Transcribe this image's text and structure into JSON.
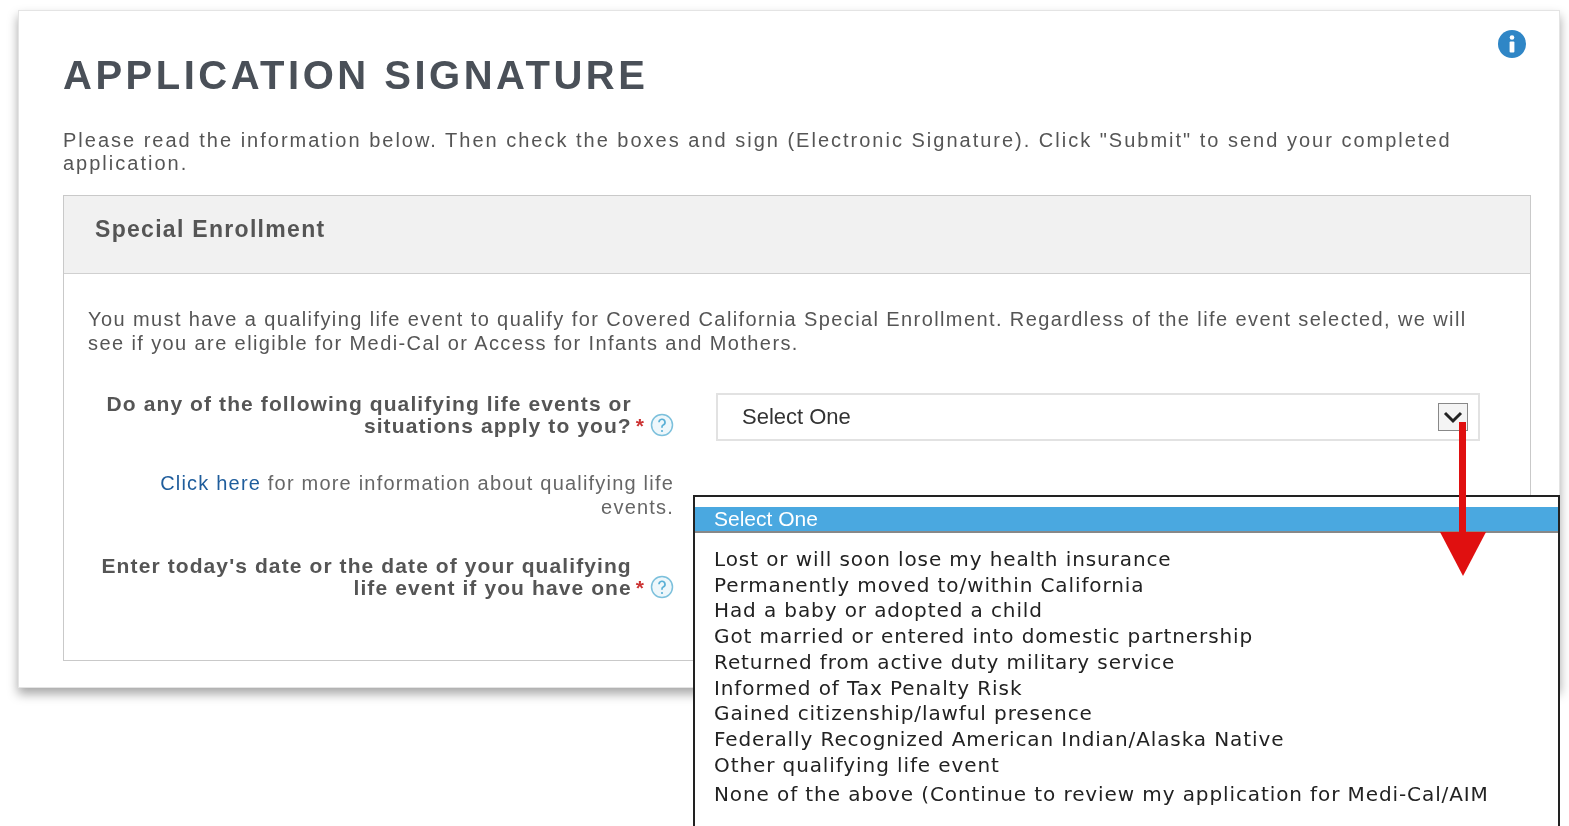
{
  "page": {
    "title": "APPLICATION SIGNATURE",
    "intro": "Please read the information below. Then check the boxes and sign (Electronic Signature). Click \"Submit\" to send your completed application."
  },
  "section": {
    "title": "Special Enrollment",
    "description": "You must have a qualifying life event to qualify for Covered California Special Enrollment. Regardless of the life event selected, we will see if you are eligible for Medi-Cal or Access for Infants and Mothers."
  },
  "questions": [
    {
      "kind": "select",
      "label": "Do any of the following qualifying life events or situations apply to you?",
      "required_mark": "*",
      "value": "Select One"
    },
    {
      "kind": "info_link",
      "link": "Click here",
      "text": "for more information about qualifying life events."
    },
    {
      "kind": "date",
      "label": "Enter today's date or the date of your qualifying life event if you have one",
      "required_mark": "*"
    }
  ],
  "dropdown": {
    "options": [
      {
        "label": "Select One",
        "selected": true
      },
      {
        "label": "Lost or will soon lose my health insurance",
        "selected": false
      },
      {
        "label": "Permanently moved to/within California",
        "selected": false
      },
      {
        "label": "Had a baby or adopted a child",
        "selected": false
      },
      {
        "label": "Got married or entered into domestic partnership",
        "selected": false
      },
      {
        "label": "Returned from active duty military service",
        "selected": false
      },
      {
        "label": "Informed of Tax Penalty Risk",
        "selected": false
      },
      {
        "label": "Gained citizenship/lawful presence",
        "selected": false
      },
      {
        "label": "Federally Recognized American Indian/Alaska Native",
        "selected": false
      },
      {
        "label": "Other qualifying life event",
        "selected": false
      },
      {
        "label": "None of the above (Continue to review my application for Medi-Cal/AIM",
        "selected": false
      }
    ]
  }
}
